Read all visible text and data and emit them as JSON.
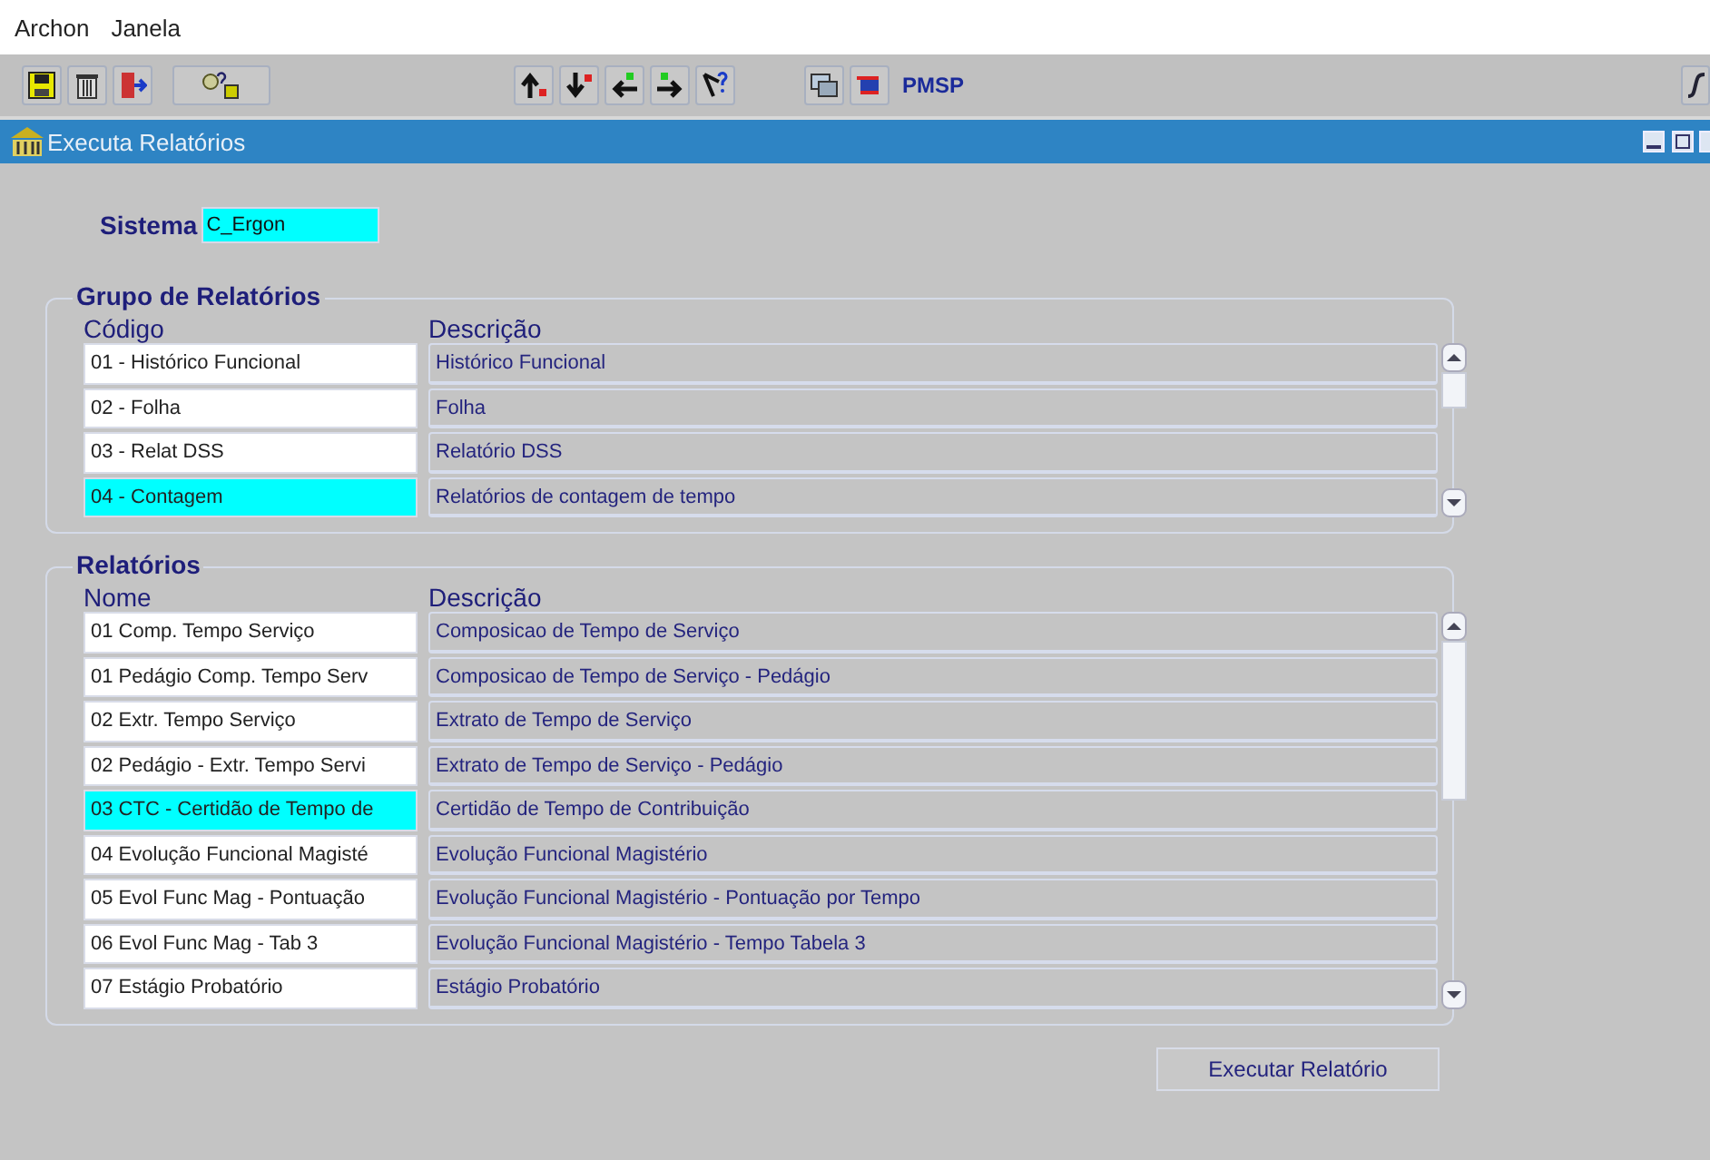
{
  "menu": [
    "Archon",
    "Janela"
  ],
  "toolbar": {
    "label": "PMSP"
  },
  "window": {
    "title": "Executa Relatórios"
  },
  "sistema": {
    "label": "Sistema",
    "value": "C_Ergon"
  },
  "groups": [
    {
      "title": "Grupo de Relatórios",
      "columns": [
        "Código",
        "Descrição"
      ],
      "rows": [
        {
          "code": "01 - Histórico Funcional",
          "description": "Histórico Funcional",
          "selected": false
        },
        {
          "code": "02 - Folha",
          "description": "Folha",
          "selected": false
        },
        {
          "code": "03 - Relat DSS",
          "description": "Relatório DSS",
          "selected": false
        },
        {
          "code": "04 - Contagem",
          "description": "Relatórios de contagem de tempo",
          "selected": true
        }
      ]
    },
    {
      "title": "Relatórios",
      "columns": [
        "Nome",
        "Descrição"
      ],
      "rows": [
        {
          "code": "01 Comp. Tempo Serviço",
          "description": "Composicao de Tempo de Serviço",
          "selected": false
        },
        {
          "code": "01 Pedágio Comp. Tempo Serv",
          "description": "Composicao de Tempo de Serviço - Pedágio",
          "selected": false
        },
        {
          "code": "02 Extr. Tempo Serviço",
          "description": "Extrato de Tempo de Serviço",
          "selected": false
        },
        {
          "code": "02 Pedágio - Extr. Tempo Servi",
          "description": "Extrato de Tempo de Serviço - Pedágio",
          "selected": false
        },
        {
          "code": "03 CTC - Certidão de Tempo de",
          "description": "Certidão de Tempo de Contribuição",
          "selected": true
        },
        {
          "code": "04 Evolução Funcional Magisté",
          "description": "Evolução Funcional Magistério",
          "selected": false
        },
        {
          "code": "05 Evol Func Mag - Pontuação",
          "description": "Evolução Funcional Magistério - Pontuação por Tempo",
          "selected": false
        },
        {
          "code": "06 Evol Func Mag - Tab 3",
          "description": "Evolução Funcional Magistério - Tempo Tabela 3",
          "selected": false
        },
        {
          "code": "07 Estágio Probatório",
          "description": "Estágio Probatório",
          "selected": false
        }
      ]
    }
  ],
  "execute_button": "Executar Relatório"
}
